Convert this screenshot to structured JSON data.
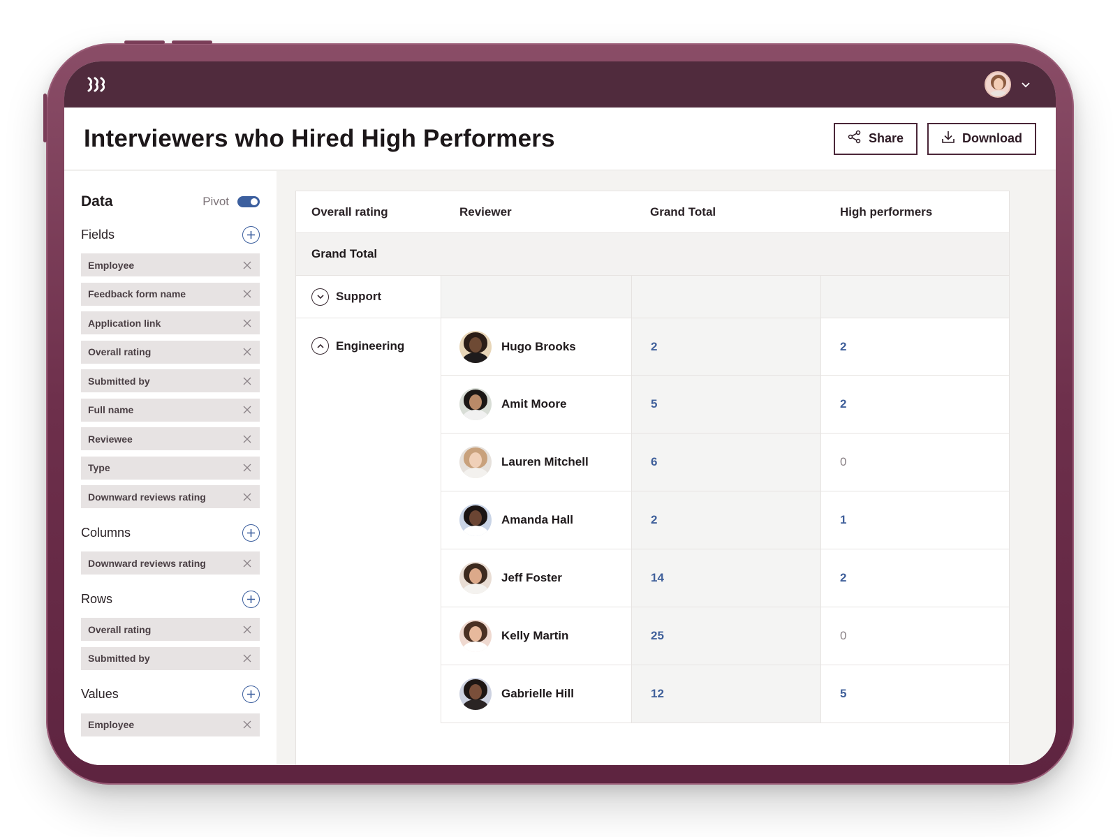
{
  "page": {
    "title": "Interviewers who Hired High Performers",
    "share_label": "Share",
    "download_label": "Download"
  },
  "sidebar": {
    "title": "Data",
    "pivot_label": "Pivot",
    "fields_label": "Fields",
    "fields": [
      "Employee",
      "Feedback form name",
      "Application link",
      "Overall rating",
      "Submitted by",
      "Full name",
      "Reviewee",
      "Type",
      "Downward reviews rating"
    ],
    "columns_label": "Columns",
    "columns": [
      "Downward reviews rating"
    ],
    "rows_label": "Rows",
    "rows": [
      "Overall rating",
      "Submitted by"
    ],
    "values_label": "Values",
    "values": [
      "Employee"
    ]
  },
  "table": {
    "headers": [
      "Overall rating",
      "Reviewer",
      "Grand Total",
      "High performers"
    ],
    "grand_total_label": "Grand Total",
    "groups": [
      {
        "label": "Support",
        "expanded": false,
        "rows": []
      },
      {
        "label": "Engineering",
        "expanded": true,
        "rows": [
          {
            "reviewer": "Hugo Brooks",
            "grand_total": "2",
            "high_performers": "2"
          },
          {
            "reviewer": "Amit Moore",
            "grand_total": "5",
            "high_performers": "2"
          },
          {
            "reviewer": "Lauren Mitchell",
            "grand_total": "6",
            "high_performers": "0"
          },
          {
            "reviewer": "Amanda Hall",
            "grand_total": "2",
            "high_performers": "1"
          },
          {
            "reviewer": "Jeff Foster",
            "grand_total": "14",
            "high_performers": "2"
          },
          {
            "reviewer": "Kelly Martin",
            "grand_total": "25",
            "high_performers": "0"
          },
          {
            "reviewer": "Gabrielle Hill",
            "grand_total": "12",
            "high_performers": "5"
          }
        ]
      }
    ]
  },
  "colors": {
    "brand": "#502b3d",
    "device": "#6d2f4b",
    "accent": "#3c5f9e"
  }
}
